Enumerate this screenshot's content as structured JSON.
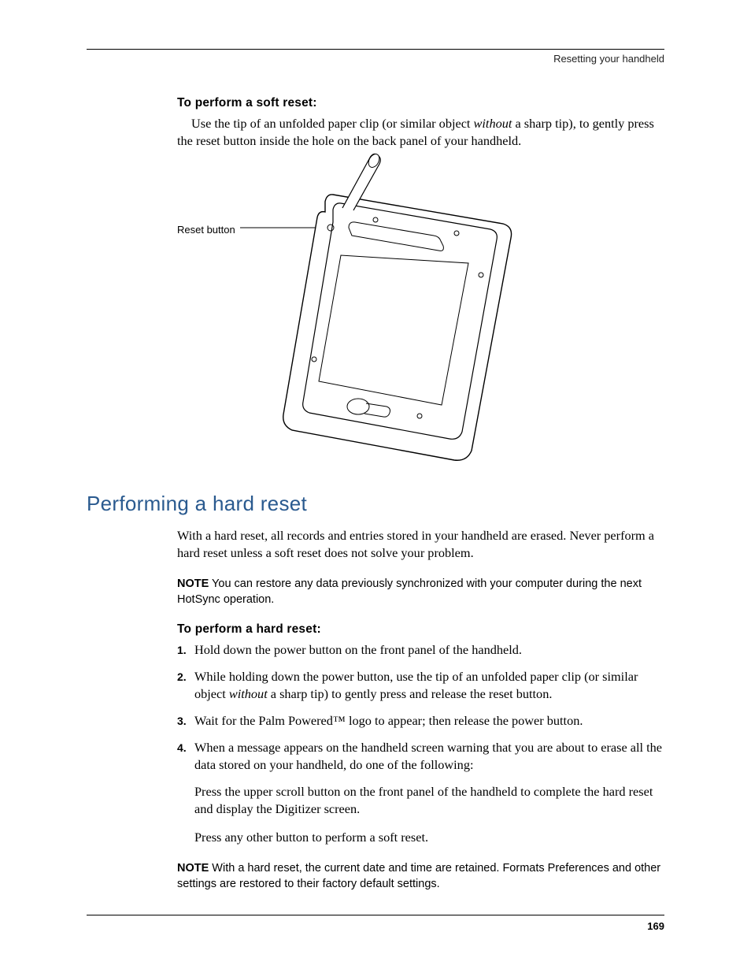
{
  "running_head": "Resetting your handheld",
  "softreset": {
    "subhead": "To perform a soft reset:",
    "para_a": "Use the tip of an unfolded paper clip (or similar object ",
    "para_ital": "without",
    "para_b": " a sharp tip), to gently press the reset button inside the hole on the back panel of your handheld.",
    "figure_label": "Reset button"
  },
  "hardreset": {
    "section_head": "Performing a hard reset",
    "intro": "With a hard reset, all records and entries stored in your handheld are erased. Never perform a hard reset unless a soft reset does not solve your problem.",
    "note1_label": "NOTE",
    "note1_body": "   You can restore any data previously synchronized with your computer during the next HotSync operation.",
    "subhead": "To perform a hard reset:",
    "steps": [
      "Hold down the power button on the front panel of the handheld.",
      "",
      "Wait for the Palm Powered™ logo to appear; then release the power button.",
      "When a message appears on the handheld screen warning that you are about to erase all the data stored on your handheld, do one of the following:"
    ],
    "step2_a": "While holding down the power button, use the tip of an unfolded paper clip (or similar object ",
    "step2_ital": "without",
    "step2_b": " a sharp tip) to gently press and release the reset button.",
    "sub1": "Press the upper scroll button on the front panel of the handheld to complete the hard reset and display the Digitizer screen.",
    "sub2": "Press any other button to perform a soft reset.",
    "note2_label": "NOTE",
    "note2_body": "   With a hard reset, the current date and time are retained. Formats Preferences and other settings are restored to their factory default settings."
  },
  "page_number": "169"
}
